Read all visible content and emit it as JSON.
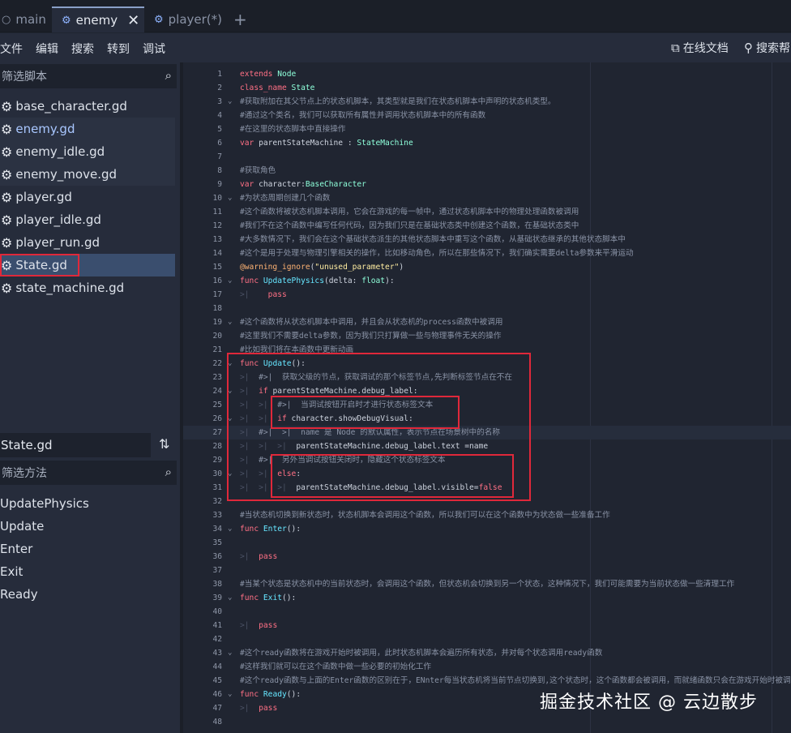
{
  "tabs": [
    {
      "label": "main",
      "icon": "circle-icon"
    },
    {
      "label": "enemy",
      "icon": "node-icon",
      "close": "✕"
    },
    {
      "label": "player(*)",
      "icon": "node-icon"
    }
  ],
  "add_tab": "+",
  "menu": [
    "文件",
    "编辑",
    "搜索",
    "转到",
    "调试"
  ],
  "online_docs": "在线文档",
  "search_help": "搜索帮",
  "filter_scripts_placeholder": "筛选脚本",
  "files": [
    "base_character.gd",
    "enemy.gd",
    "enemy_idle.gd",
    "enemy_move.gd",
    "player.gd",
    "player_idle.gd",
    "player_run.gd",
    "State.gd",
    "state_machine.gd"
  ],
  "current_script": "State.gd",
  "filter_methods_placeholder": "筛选方法",
  "methods": [
    "UpdatePhysics",
    "Update",
    "Enter",
    "Exit",
    "Ready"
  ],
  "watermark": "掘金技术社区 @ 云边散步",
  "code_lines": [
    {
      "n": "1",
      "html": "<span class='kw'>extends</span> <span class='ty'>Node</span>"
    },
    {
      "n": "2",
      "html": "<span class='kw'>class_name</span> <span class='ty'>State</span>"
    },
    {
      "n": "3",
      "fold": "⌄",
      "html": "<span class='cm'>#获取附加在其父节点上的状态机脚本，其类型就是我们在状态机脚本中声明的状态机类型。</span>"
    },
    {
      "n": "4",
      "html": "<span class='cm'>#通过这个类名，我们可以获取所有属性并调用状态机脚本中的所有函数</span>"
    },
    {
      "n": "5",
      "html": "<span class='cm'>#在这里的状态脚本中直接操作</span>"
    },
    {
      "n": "6",
      "html": "<span class='kw'>var</span> parentStateMachine : <span class='ty'>StateMachine</span>"
    },
    {
      "n": "7",
      "html": ""
    },
    {
      "n": "8",
      "html": "<span class='cm'>#获取角色</span>"
    },
    {
      "n": "9",
      "html": "<span class='kw'>var</span> character:<span class='ty'>BaseCharacter</span>"
    },
    {
      "n": "10",
      "fold": "⌄",
      "html": "<span class='cm'>#为状态周期创建几个函数</span>"
    },
    {
      "n": "11",
      "html": "<span class='cm'>#这个函数将被状态机脚本调用，它会在游戏的每一帧中，通过状态机脚本中的物理处理函数被调用</span>"
    },
    {
      "n": "12",
      "html": "<span class='cm'>#我们不在这个函数中编写任何代码，因为我们只是在基础状态类中创建这个函数，在基础状态类中</span>"
    },
    {
      "n": "13",
      "html": "<span class='cm'>#大多数情况下，我们会在这个基础状态派生的其他状态脚本中重写这个函数，从基础状态继承的其他状态脚本中</span>"
    },
    {
      "n": "14",
      "html": "<span class='cm'>#这个是用于处理与物理引擎相关的操作，比如移动角色，所以在那些情况下，我们确实需要delta参数来平滑运动</span>"
    },
    {
      "n": "15",
      "html": "<span class='an'>@warning_ignore</span>(<span class='st'>\"unused_parameter\"</span>)"
    },
    {
      "n": "16",
      "fold": "⌄",
      "html": "<span class='kw'>func</span> <span class='fn'>UpdatePhysics</span>(delta: <span class='ty'>float</span>):"
    },
    {
      "n": "17",
      "html": "<span class='tb'>&gt;|</span>    <span class='kw'>pass</span>"
    },
    {
      "n": "18",
      "html": ""
    },
    {
      "n": "19",
      "fold": "⌄",
      "html": "<span class='cm'>#这个函数将从状态机脚本中调用，并且会从状态机的process函数中被调用</span>"
    },
    {
      "n": "20",
      "html": "<span class='cm'>#这里我们不需要delta参数，因为我们只打算做一些与物理事件无关的操作</span>"
    },
    {
      "n": "21",
      "html": "<span class='cm'>#比如我们将在本函数中更新动画</span>"
    },
    {
      "n": "22",
      "fold": "⌄",
      "html": "<span class='kw'>func</span> <span class='fn'>Update</span>():"
    },
    {
      "n": "23",
      "html": "<span class='tb'>&gt;|</span>  <span class='cm'>#&gt;|  获取父级的节点，获取调试的那个标签节点,先判断标签节点在不在</span>"
    },
    {
      "n": "24",
      "fold": "⌄",
      "html": "<span class='tb'>&gt;|</span>  <span class='kw'>if</span> parentStateMachine.debug_label:"
    },
    {
      "n": "25",
      "html": "<span class='tb'>&gt;|  &gt;|</span>  <span class='cm'>#&gt;|  当调试按钮开启时才进行状态标签文本</span>"
    },
    {
      "n": "26",
      "fold": "⌄",
      "html": "<span class='tb'>&gt;|  &gt;|</span>  <span class='kw'>if</span> character.showDebugVisual:"
    },
    {
      "n": "27",
      "cur": true,
      "html": "<span class='tb'>&gt;|</span>  <span class='cm'>#&gt;|  &gt;|  name 是 Node 的默认属性，表示节点在场景树中的名称</span>"
    },
    {
      "n": "28",
      "html": "<span class='tb'>&gt;|  &gt;|  &gt;|</span>  parentStateMachine.debug_label.text =name"
    },
    {
      "n": "29",
      "html": "<span class='tb'>&gt;|</span>  <span class='cm'>#&gt;|  另外当调试按钮关闭时，隐藏这个状态标签文本</span>"
    },
    {
      "n": "30",
      "fold": "⌄",
      "html": "<span class='tb'>&gt;|  &gt;|</span>  <span class='kw'>else</span>:"
    },
    {
      "n": "31",
      "html": "<span class='tb'>&gt;|  &gt;|  &gt;|</span>  parentStateMachine.debug_label.visible=<span class='kw'>false</span>"
    },
    {
      "n": "32",
      "html": ""
    },
    {
      "n": "33",
      "html": "<span class='cm'>#当状态机切换到新状态时，状态机脚本会调用这个函数，所以我们可以在这个函数中为状态做一些准备工作</span>"
    },
    {
      "n": "34",
      "fold": "⌄",
      "html": "<span class='kw'>func</span> <span class='fn'>Enter</span>():"
    },
    {
      "n": "35",
      "html": ""
    },
    {
      "n": "36",
      "html": "<span class='tb'>&gt;|</span>  <span class='kw'>pass</span>"
    },
    {
      "n": "37",
      "html": ""
    },
    {
      "n": "38",
      "html": "<span class='cm'>#当某个状态是状态机中的当前状态时，会调用这个函数，但状态机会切换到另一个状态，这种情况下，我们可能需要为当前状态做一些清理工作</span>"
    },
    {
      "n": "39",
      "fold": "⌄",
      "html": "<span class='kw'>func</span> <span class='fn'>Exit</span>():"
    },
    {
      "n": "40",
      "html": ""
    },
    {
      "n": "41",
      "html": "<span class='tb'>&gt;|</span>  <span class='kw'>pass</span>"
    },
    {
      "n": "42",
      "html": ""
    },
    {
      "n": "43",
      "fold": "⌄",
      "html": "<span class='cm'>#这个ready函数将在游戏开始时被调用，此时状态机脚本会遍历所有状态，并对每个状态调用ready函数</span>"
    },
    {
      "n": "44",
      "html": "<span class='cm'>#这样我们就可以在这个函数中做一些必要的初始化工作</span>"
    },
    {
      "n": "45",
      "html": "<span class='cm'>#这个ready函数与上面的Enter函数的区别在于，ENnter每当状态机将当前节点切换到,这个状态时，这个函数都会被调用，而就绪函数只会在游戏开始时被调用一次</span>"
    },
    {
      "n": "46",
      "fold": "⌄",
      "html": "<span class='kw'>func</span> <span class='fn'>Ready</span>():"
    },
    {
      "n": "47",
      "html": "<span class='tb'>&gt;|</span>  <span class='kw'>pass</span>"
    },
    {
      "n": "48",
      "html": ""
    }
  ]
}
